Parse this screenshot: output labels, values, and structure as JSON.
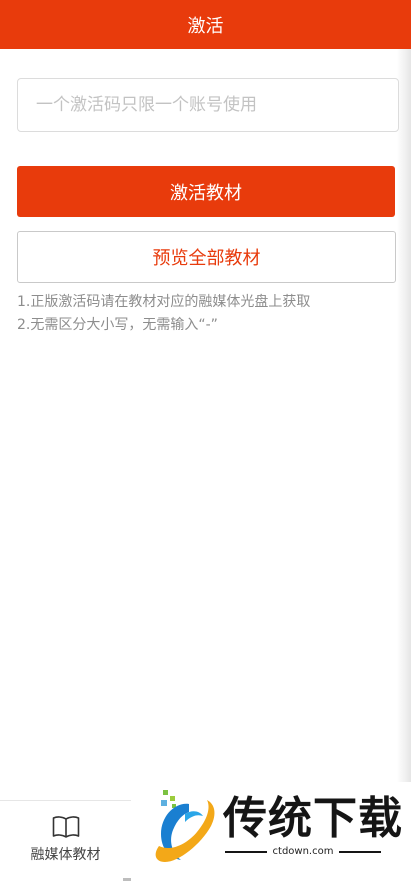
{
  "header": {
    "title": "激活"
  },
  "activation": {
    "input_placeholder": "一个激活码只限一个账号使用",
    "input_value": "",
    "activate_label": "激活教材",
    "preview_label": "预览全部教材"
  },
  "notes": [
    "1.正版激活码请在教材对应的融媒体光盘上获取",
    "2.无需区分大小写，无需输入“-”"
  ],
  "bottom_nav": {
    "tabs": [
      {
        "label": "融媒体教材",
        "icon": "book-icon"
      }
    ]
  },
  "watermark": {
    "name": "传统下载",
    "domain": "ctdown.com"
  },
  "colors": {
    "accent": "#e83b0c",
    "note_text": "#8d8d8d",
    "border": "#dcdcdc"
  }
}
